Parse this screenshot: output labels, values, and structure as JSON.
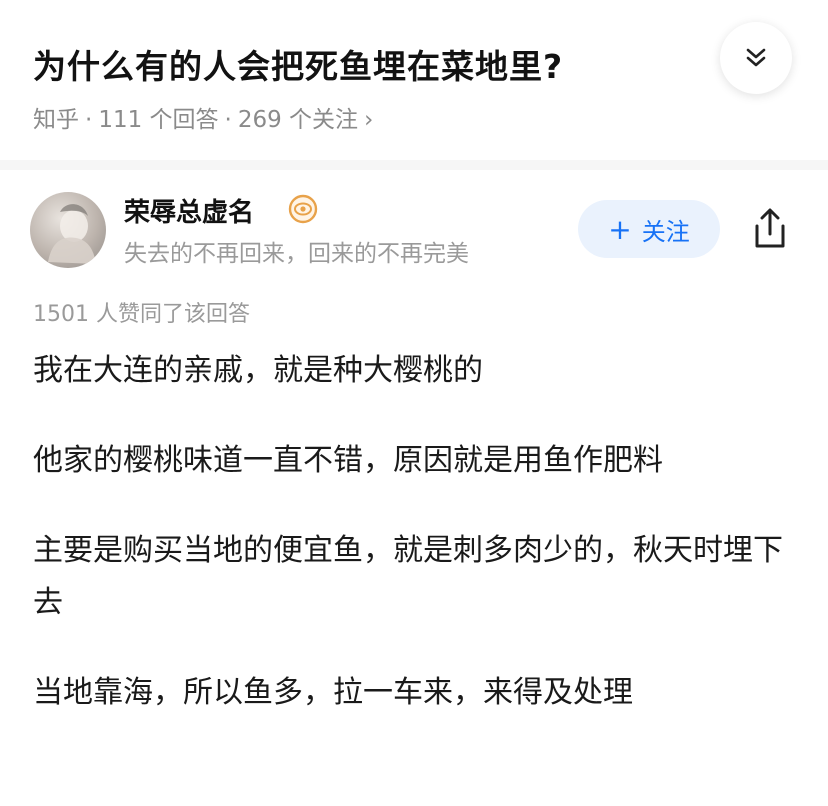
{
  "question": {
    "title": "为什么有的人会把死鱼埋在菜地里?",
    "source": "知乎",
    "answers_count": "111 个回答",
    "followers_count": "269 个关注",
    "chevron": "›"
  },
  "author": {
    "name": "荣辱总虚名",
    "bio": "失去的不再回来，回来的不再完美",
    "follow_label": "关注",
    "follow_plus": "+"
  },
  "answer": {
    "likes": "1501 人赞同了该回答",
    "paragraphs": [
      "我在大连的亲戚，就是种大樱桃的",
      "他家的樱桃味道一直不错，原因就是用鱼作肥料",
      "主要是购买当地的便宜鱼，就是刺多肉少的，秋天时埋下去",
      "当地靠海，所以鱼多，拉一车来，来得及处理"
    ]
  },
  "colors": {
    "accent": "#1772f6",
    "follow_bg": "#eaf2fd",
    "meta_text": "#8a8a8a",
    "badge": "#e8a24a"
  },
  "icons": {
    "collapse": "double-chevron-down-icon",
    "badge": "eye-badge-icon",
    "share": "share-icon"
  }
}
